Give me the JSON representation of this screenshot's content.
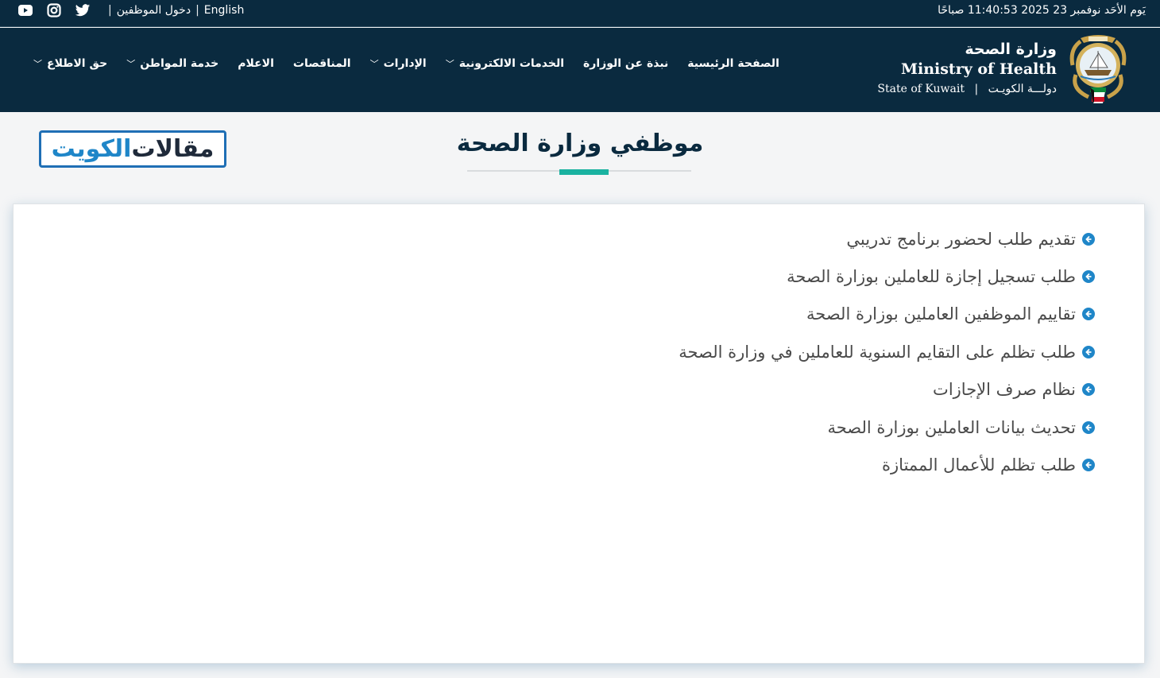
{
  "topbar": {
    "datetime": "يَوم الأحَد نوفمبر 23 2025 11:40:53 صباحًا",
    "language_link": "English",
    "separator": "|",
    "staff_login": "دخول الموظفين",
    "social": [
      "youtube-icon",
      "instagram-icon",
      "twitter-icon"
    ]
  },
  "brand": {
    "name_ar": "وزارة الصحة",
    "name_en": "Ministry of Health",
    "state_en": "State of Kuwait",
    "state_sep": "|",
    "state_ar": "دولـــة الكويـت"
  },
  "nav": {
    "items": [
      {
        "label": "الصفحة الرئيسية",
        "dropdown": false
      },
      {
        "label": "نبذة عن الوزارة",
        "dropdown": false
      },
      {
        "label": "الخدمات الالكترونية",
        "dropdown": true
      },
      {
        "label": "الإدارات",
        "dropdown": true
      },
      {
        "label": "المناقصات",
        "dropdown": false
      },
      {
        "label": "الاعلام",
        "dropdown": false
      },
      {
        "label": "خدمة المواطن",
        "dropdown": true
      },
      {
        "label": "حق الاطلاع",
        "dropdown": true
      }
    ]
  },
  "page": {
    "title": "موظفي وزارة الصحة",
    "logo_part1": "مقالات",
    "logo_part2": "الكويت"
  },
  "links": [
    "تقديم طلب لحضور برنامج تدريبي",
    "طلب تسجيل إجازة للعاملين بوزارة الصحة",
    "تقاييم الموظفين العاملين بوزارة الصحة",
    "طلب تظلم على التقايم السنوية للعاملين في وزارة الصحة",
    "نظام صرف الإجازات",
    "تحديث بيانات العاملين بوزارة الصحة",
    "طلب تظلم للأعمال الممتازة"
  ],
  "colors": {
    "header_bg": "#0a2a3f",
    "accent_teal": "#1ab2a0",
    "link_blue": "#1f86c8"
  }
}
